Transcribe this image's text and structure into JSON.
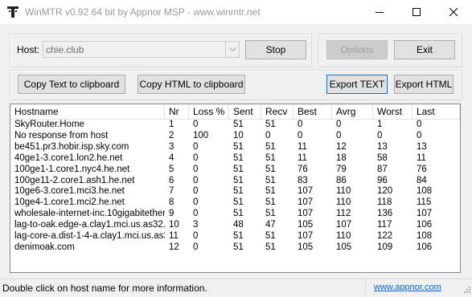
{
  "window": {
    "title": "WinMTR v0.92 64 bit by Appnor MSP - www.winmtr.net"
  },
  "host": {
    "label": "Host:",
    "value": "chie.club"
  },
  "buttons": {
    "stop": "Stop",
    "options": "Options",
    "exit": "Exit",
    "copy_text": "Copy Text to clipboard",
    "copy_html": "Copy HTML to clipboard",
    "export_text": "Export TEXT",
    "export_html": "Export HTML"
  },
  "table": {
    "columns": [
      "Hostname",
      "Nr",
      "Loss %",
      "Sent",
      "Recv",
      "Best",
      "Avrg",
      "Worst",
      "Last"
    ],
    "rows": [
      [
        "SkyRouter.Home",
        "1",
        "0",
        "51",
        "51",
        "0",
        "0",
        "1",
        "0"
      ],
      [
        "No response from host",
        "2",
        "100",
        "10",
        "0",
        "0",
        "0",
        "0",
        "0"
      ],
      [
        "be451.pr3.hobir.isp.sky.com",
        "3",
        "0",
        "51",
        "51",
        "11",
        "12",
        "13",
        "13"
      ],
      [
        "40ge1-3.core1.lon2.he.net",
        "4",
        "0",
        "51",
        "51",
        "11",
        "18",
        "58",
        "11"
      ],
      [
        "100ge1-1.core1.nyc4.he.net",
        "5",
        "0",
        "51",
        "51",
        "76",
        "79",
        "87",
        "76"
      ],
      [
        "100ge11-2.core1.ash1.he.net",
        "6",
        "0",
        "51",
        "51",
        "83",
        "86",
        "96",
        "84"
      ],
      [
        "10ge6-3.core1.mci3.he.net",
        "7",
        "0",
        "51",
        "51",
        "107",
        "110",
        "120",
        "108"
      ],
      [
        "10ge4-1.core1.mci2.he.net",
        "8",
        "0",
        "51",
        "51",
        "107",
        "110",
        "118",
        "115"
      ],
      [
        "wholesale-internet-inc.10gigabitether...",
        "9",
        "0",
        "51",
        "51",
        "107",
        "112",
        "136",
        "107"
      ],
      [
        "lag-to-oak.edge-a.clay1.mci.us.as32...",
        "10",
        "3",
        "48",
        "47",
        "105",
        "107",
        "117",
        "106"
      ],
      [
        "lag-core-a.dist-1-4-a.clay1.mci.us.as3...",
        "11",
        "0",
        "51",
        "51",
        "107",
        "110",
        "122",
        "108"
      ],
      [
        "denimoak.com",
        "12",
        "0",
        "51",
        "51",
        "105",
        "105",
        "109",
        "106"
      ]
    ]
  },
  "status": {
    "hint": "Double click on host name for more information.",
    "link": "www.appnor.com"
  },
  "colors": {
    "link": "#0066cc",
    "focus_border": "#0078d7",
    "window_bg": "#f0f0f0"
  }
}
